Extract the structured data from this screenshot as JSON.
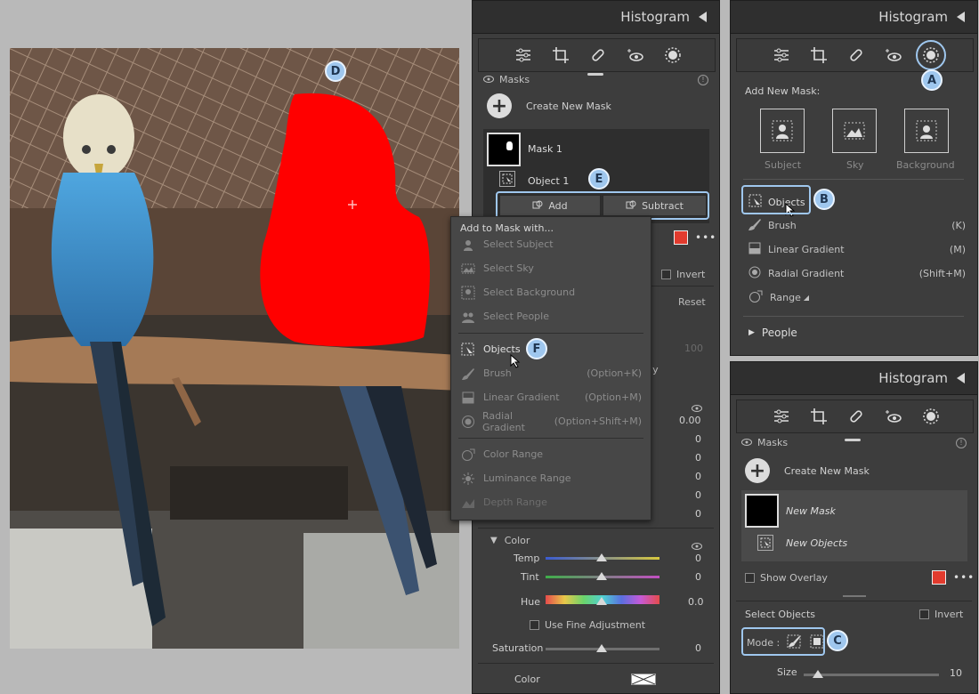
{
  "colors": {
    "accent": "#9fc7ee",
    "overlay_red": "#ff0000",
    "panel": "#3d3d3d",
    "swatch_red": "#e23b2e"
  },
  "callouts": {
    "a": "A",
    "b": "B",
    "c": "C",
    "d": "D",
    "e": "E",
    "f": "F"
  },
  "panel1": {
    "title": "Histogram",
    "masks_label": "Masks",
    "create_new_mask": "Create New Mask",
    "mask1": "Mask 1",
    "object1": "Object 1",
    "add": "Add",
    "subtract": "Subtract",
    "invert": "Invert",
    "reset": "Reset",
    "hidden_value_100": "100",
    "hidden_text_lly": "lly",
    "values": [
      "0.00",
      "0",
      "0",
      "0",
      "0",
      "0"
    ],
    "color_section": "Color",
    "sliders": [
      {
        "label": "Temp",
        "value": "0"
      },
      {
        "label": "Tint",
        "value": "0"
      },
      {
        "label": "Hue",
        "value": "0.0"
      }
    ],
    "fine_adjustment": "Use Fine Adjustment",
    "saturation": {
      "label": "Saturation",
      "value": "0"
    },
    "color_label": "Color"
  },
  "dropdown": {
    "title": "Add to Mask with...",
    "items": [
      {
        "label": "Select Subject",
        "shortcut": "",
        "icon": "subject-icon"
      },
      {
        "label": "Select Sky",
        "shortcut": "",
        "icon": "sky-icon"
      },
      {
        "label": "Select Background",
        "shortcut": "",
        "icon": "background-icon"
      },
      {
        "label": "Select People",
        "shortcut": "",
        "icon": "people-icon"
      },
      {
        "label": "Objects",
        "shortcut": "",
        "icon": "objects-icon"
      },
      {
        "label": "Brush",
        "shortcut": "(Option+K)",
        "icon": "brush-icon"
      },
      {
        "label": "Linear Gradient",
        "shortcut": "(Option+M)",
        "icon": "linear-gradient-icon"
      },
      {
        "label": "Radial Gradient",
        "shortcut": "(Option+Shift+M)",
        "icon": "radial-gradient-icon"
      },
      {
        "label": "Color Range",
        "shortcut": "",
        "icon": "color-range-icon"
      },
      {
        "label": "Luminance Range",
        "shortcut": "",
        "icon": "luminance-range-icon"
      },
      {
        "label": "Depth Range",
        "shortcut": "",
        "icon": "depth-range-icon"
      }
    ]
  },
  "panel2": {
    "title": "Histogram",
    "add_new_mask": "Add New Mask:",
    "tiles": [
      "Subject",
      "Sky",
      "Background"
    ],
    "objects": "Objects",
    "brush": {
      "label": "Brush",
      "shortcut": "(K)"
    },
    "linear": {
      "label": "Linear Gradient",
      "shortcut": "(M)"
    },
    "radial": {
      "label": "Radial Gradient",
      "shortcut": "(Shift+M)"
    },
    "range": "Range",
    "people": "People"
  },
  "panel3": {
    "title": "Histogram",
    "masks_label": "Masks",
    "create_new_mask": "Create New Mask",
    "new_mask": "New Mask",
    "new_objects": "New Objects",
    "show_overlay": "Show Overlay",
    "select_objects": "Select Objects",
    "invert": "Invert",
    "mode_label": "Mode :",
    "size": {
      "label": "Size",
      "value": "10"
    }
  }
}
